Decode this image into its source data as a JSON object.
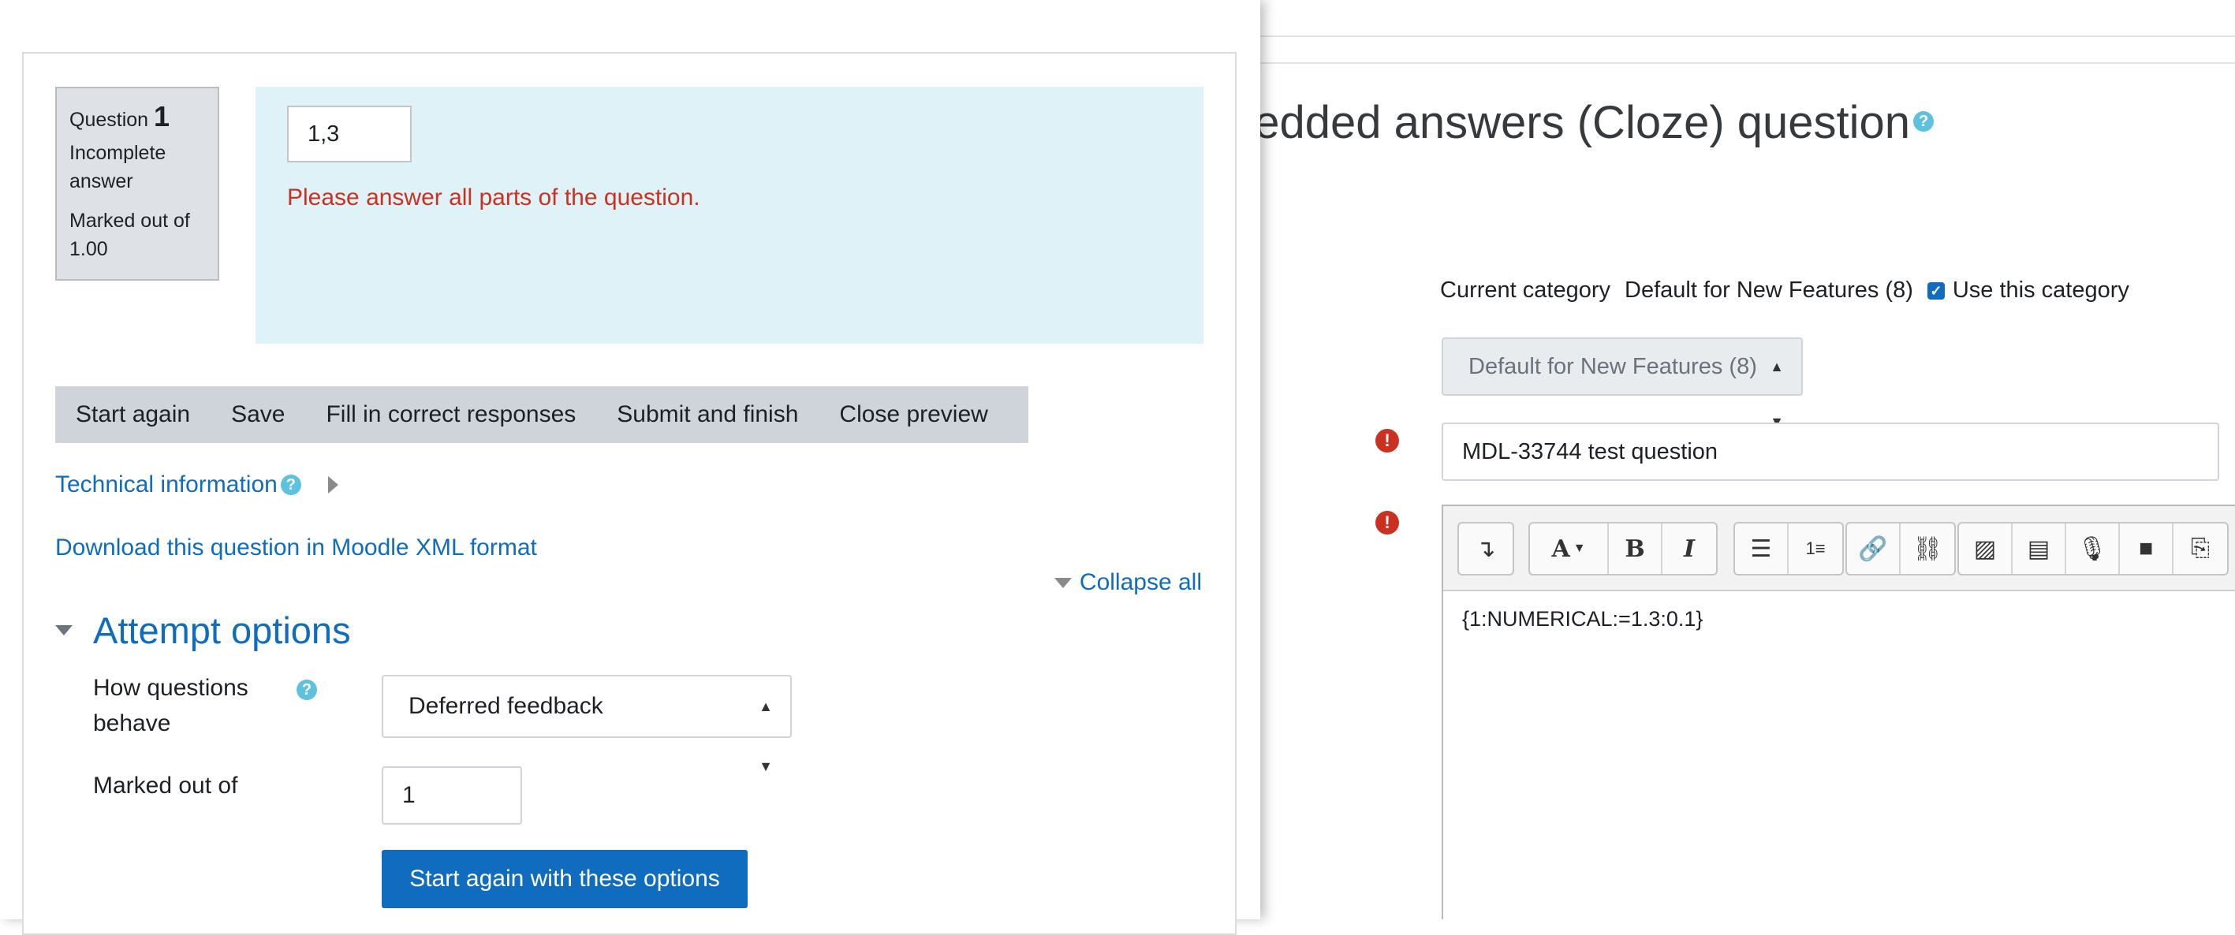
{
  "preview": {
    "qinfo": {
      "question_word": "Question",
      "number": "1",
      "state": "Incomplete answer",
      "grade": "Marked out of 1.00"
    },
    "answer_value": "1,3",
    "validation_error": "Please answer all parts of the question.",
    "controls": [
      "Start again",
      "Save",
      "Fill in correct responses",
      "Submit and finish",
      "Close preview"
    ],
    "technical_info": "Technical information",
    "download_link": "Download this question in Moodle XML format",
    "collapse_all": "Collapse all",
    "attempt_options": {
      "title": "Attempt options",
      "behave_label": "How questions behave",
      "behave_value": "Deferred feedback",
      "marked_label": "Marked out of",
      "marked_value": "1",
      "submit_label": "Start again with these options"
    }
  },
  "edit_form": {
    "title": "bedded answers (Cloze) question",
    "current_category_label": "Current category",
    "current_category_value": "Default for New Features (8)",
    "use_category_label": "Use this category",
    "category_select_value": "Default for New Features (8)",
    "question_name": "MDL-33744 test question",
    "question_text": "{1:NUMERICAL:=1.3:0.1}"
  },
  "icons": {
    "help": "help-icon",
    "required": "required-icon",
    "toolbar": [
      "toggle-toolbar-icon",
      "font-style-icon",
      "bold-icon",
      "italic-icon",
      "unordered-list-icon",
      "ordered-list-icon",
      "link-icon",
      "unlink-icon",
      "image-icon",
      "media-icon",
      "record-audio-icon",
      "record-video-icon",
      "manage-files-icon"
    ]
  },
  "colors": {
    "link_blue": "#0f6cbf",
    "error_red": "#ca3120",
    "formulation_bg": "#def2f8",
    "help_blue": "#5fc1e0"
  }
}
